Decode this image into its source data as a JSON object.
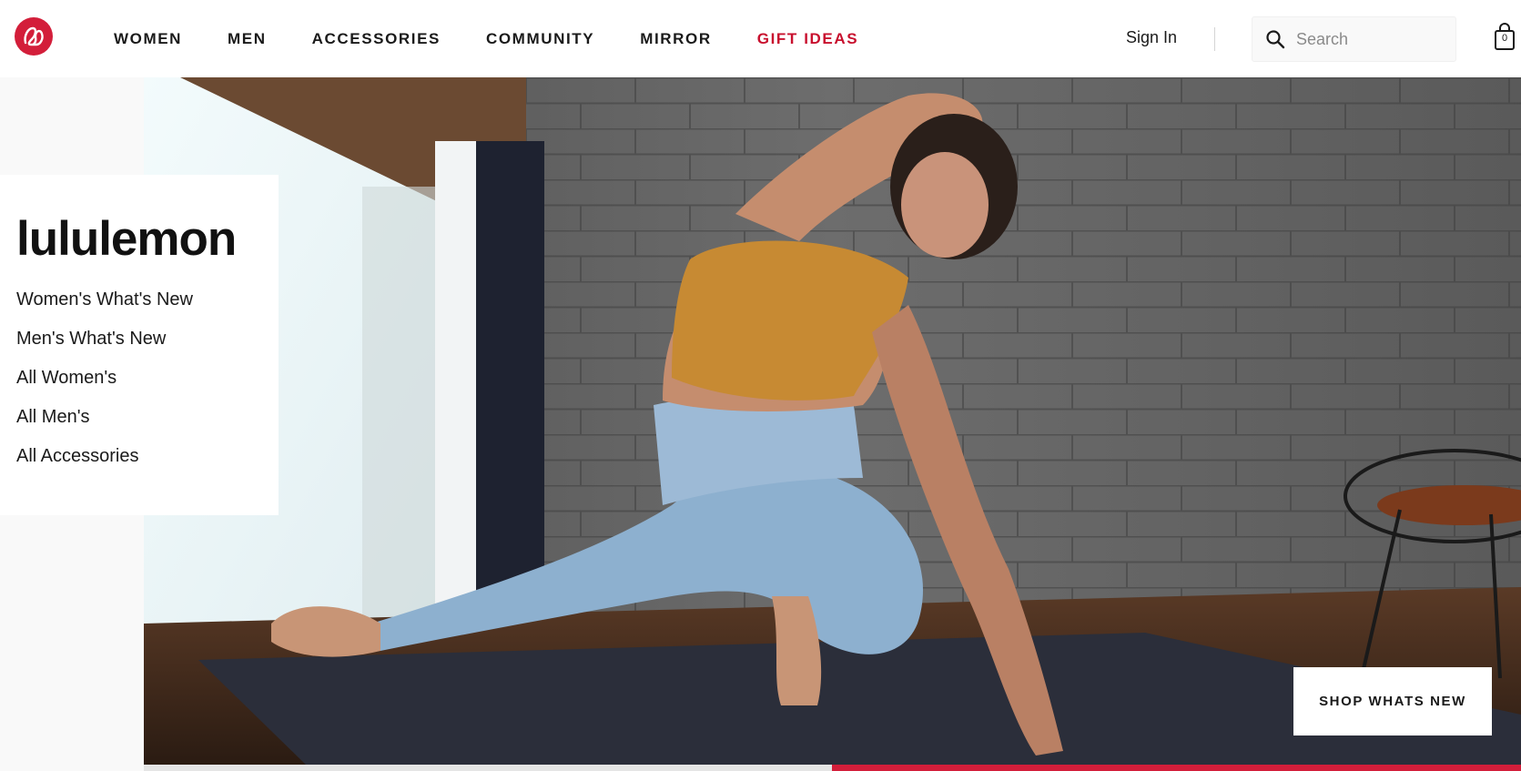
{
  "header": {
    "logo_icon": "lululemon-logo-icon",
    "nav": [
      {
        "label": "WOMEN"
      },
      {
        "label": "MEN"
      },
      {
        "label": "ACCESSORIES"
      },
      {
        "label": "COMMUNITY"
      },
      {
        "label": "MIRROR"
      },
      {
        "label": "GIFT IDEAS",
        "color": "#c8102e"
      }
    ],
    "sign_in": "Sign In",
    "search": {
      "placeholder": "Search",
      "icon": "search-icon"
    },
    "bag": {
      "icon": "shopping-bag-icon",
      "count": "0"
    }
  },
  "hero": {
    "brand": "lululemon",
    "links": [
      "Women's What's New",
      "Men's What's New",
      "All Women's",
      "All Men's",
      "All Accessories"
    ],
    "cta": "SHOP WHATS NEW",
    "carousel_progress": 0.5
  },
  "colors": {
    "brand_red": "#d31e3a",
    "text": "#1a1a1a",
    "panel_bg": "#ffffff",
    "page_bg": "#f9f9f9"
  }
}
